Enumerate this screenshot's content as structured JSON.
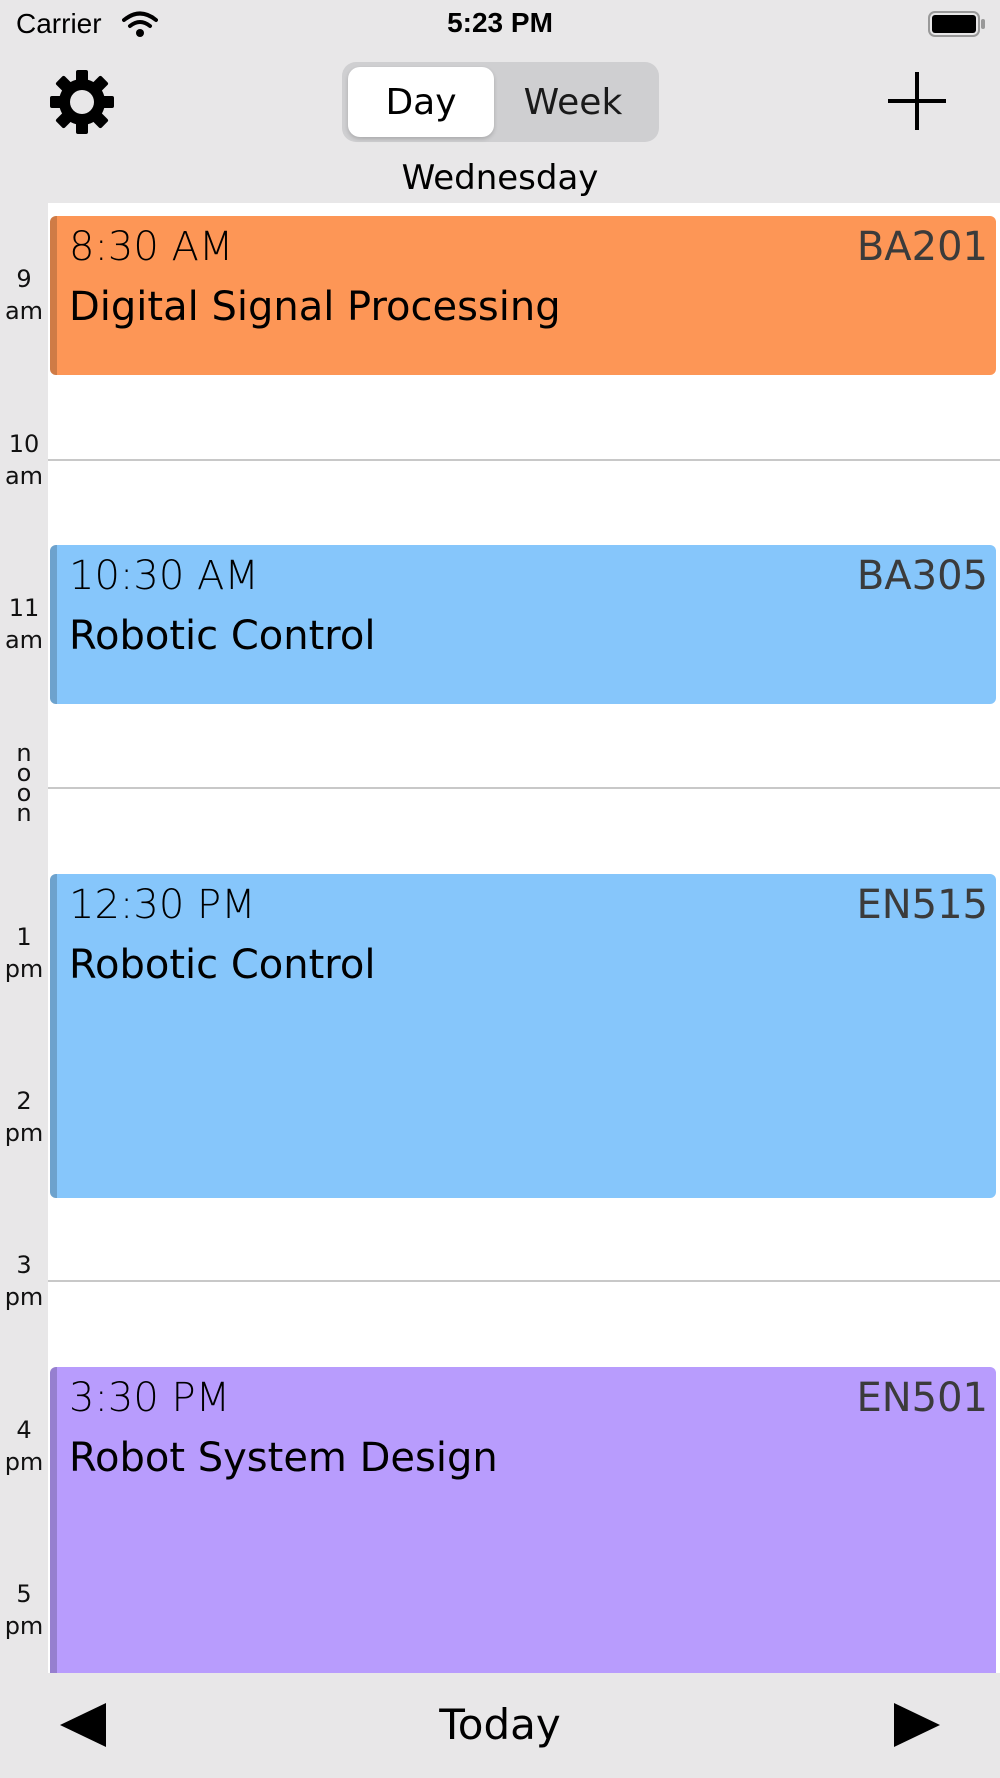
{
  "status": {
    "carrier": "Carrier",
    "time": "5:23 PM"
  },
  "nav": {
    "segments": [
      "Day",
      "Week"
    ],
    "selected": "Day",
    "day_name": "Wednesday"
  },
  "hours": [
    {
      "num": "9",
      "ampm": "am"
    },
    {
      "num": "10",
      "ampm": "am"
    },
    {
      "num": "11",
      "ampm": "am"
    },
    {
      "num": "1",
      "ampm": "pm"
    },
    {
      "num": "2",
      "ampm": "pm"
    },
    {
      "num": "3",
      "ampm": "pm"
    },
    {
      "num": "4",
      "ampm": "pm"
    },
    {
      "num": "5",
      "ampm": "pm"
    }
  ],
  "noon_label": [
    "n",
    "o",
    "o",
    "n"
  ],
  "events": [
    {
      "time": "8:30 AM",
      "room": "BA201",
      "title": "Digital Signal Processing",
      "color": "#fd9656"
    },
    {
      "time": "10:30 AM",
      "room": "BA305",
      "title": "Robotic Control",
      "color": "#86c6fb"
    },
    {
      "time": "12:30 PM",
      "room": "EN515",
      "title": "Robotic Control",
      "color": "#86c6fb"
    },
    {
      "time": "3:30 PM",
      "room": "EN501",
      "title": "Robot System Design",
      "color": "#b89cfd"
    }
  ],
  "toolbar": {
    "today_label": "Today"
  },
  "icons": {
    "settings": "gear-icon",
    "add": "plus-icon",
    "prev": "triangle-left-icon",
    "next": "triangle-right-icon",
    "wifi": "wifi-icon",
    "battery": "battery-icon"
  }
}
